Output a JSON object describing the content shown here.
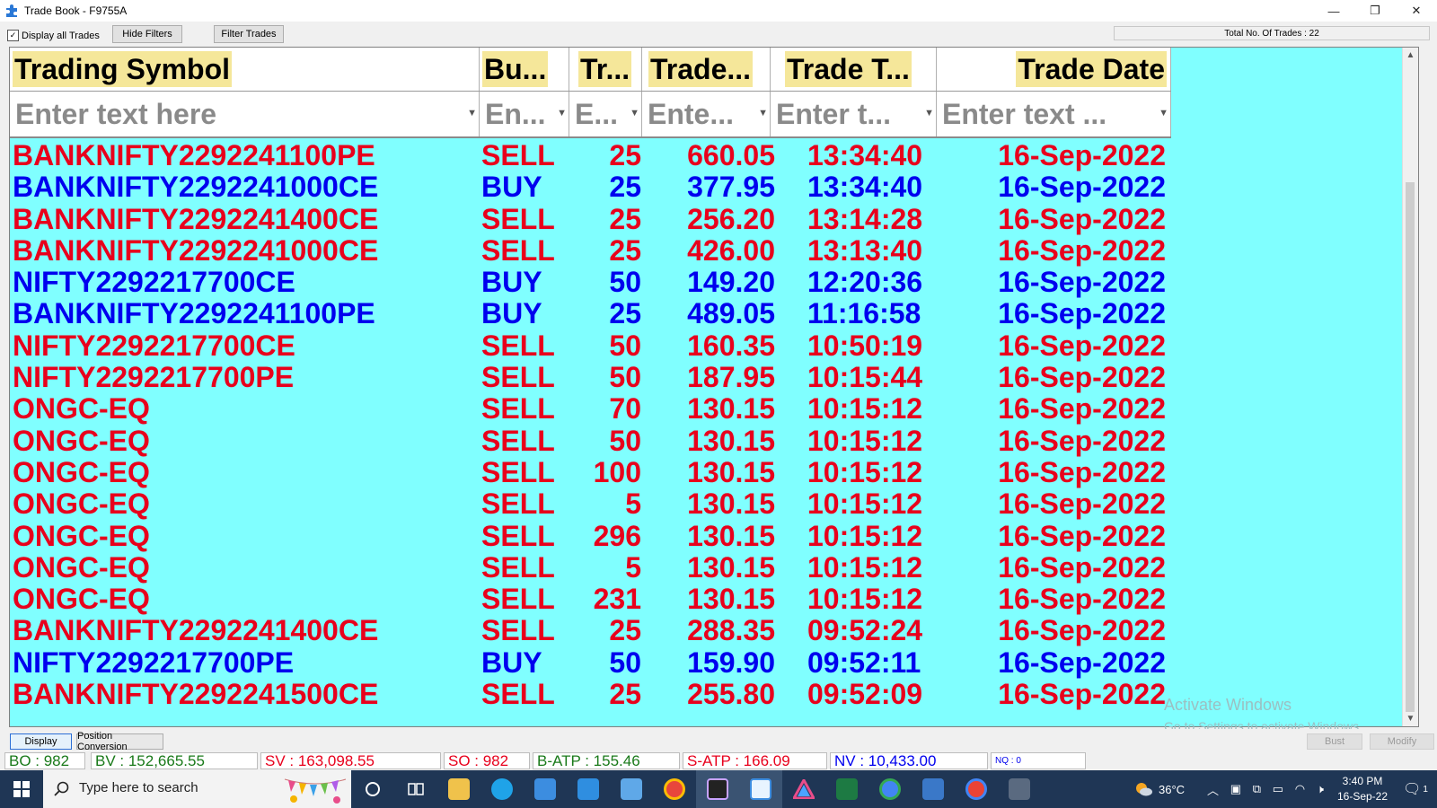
{
  "window": {
    "title": "Trade Book - F9755A",
    "controls": {
      "minimize": "—",
      "restore": "❐",
      "close": "✕"
    }
  },
  "toolbar": {
    "display_all_label": "Display all Trades",
    "display_all_checked": "✓",
    "hide_filters_label": "Hide Filters",
    "filter_trades_label": "Filter Trades",
    "total_trades": "Total No. Of Trades : 22"
  },
  "columns": [
    {
      "header": "Trading Symbol",
      "filter": "Enter text here"
    },
    {
      "header": "Bu...",
      "filter": "En..."
    },
    {
      "header": "Tr...",
      "filter": "E..."
    },
    {
      "header": "Trade...",
      "filter": "Ente..."
    },
    {
      "header": "Trade T...",
      "filter": "Enter t..."
    },
    {
      "header": "Trade Date",
      "filter": "Enter text ..."
    }
  ],
  "filter_icon": "▼",
  "trades": [
    {
      "symbol": "BANKNIFTY2292241100PE",
      "side": "SELL",
      "qty": "25",
      "price": "660.05",
      "time": "13:34:40",
      "date": "16-Sep-2022"
    },
    {
      "symbol": "BANKNIFTY2292241000CE",
      "side": "BUY",
      "qty": "25",
      "price": "377.95",
      "time": "13:34:40",
      "date": "16-Sep-2022"
    },
    {
      "symbol": "BANKNIFTY2292241400CE",
      "side": "SELL",
      "qty": "25",
      "price": "256.20",
      "time": "13:14:28",
      "date": "16-Sep-2022"
    },
    {
      "symbol": "BANKNIFTY2292241000CE",
      "side": "SELL",
      "qty": "25",
      "price": "426.00",
      "time": "13:13:40",
      "date": "16-Sep-2022"
    },
    {
      "symbol": "NIFTY2292217700CE",
      "side": "BUY",
      "qty": "50",
      "price": "149.20",
      "time": "12:20:36",
      "date": "16-Sep-2022"
    },
    {
      "symbol": "BANKNIFTY2292241100PE",
      "side": "BUY",
      "qty": "25",
      "price": "489.05",
      "time": "11:16:58",
      "date": "16-Sep-2022"
    },
    {
      "symbol": "NIFTY2292217700CE",
      "side": "SELL",
      "qty": "50",
      "price": "160.35",
      "time": "10:50:19",
      "date": "16-Sep-2022"
    },
    {
      "symbol": "NIFTY2292217700PE",
      "side": "SELL",
      "qty": "50",
      "price": "187.95",
      "time": "10:15:44",
      "date": "16-Sep-2022"
    },
    {
      "symbol": "ONGC-EQ",
      "side": "SELL",
      "qty": "70",
      "price": "130.15",
      "time": "10:15:12",
      "date": "16-Sep-2022"
    },
    {
      "symbol": "ONGC-EQ",
      "side": "SELL",
      "qty": "50",
      "price": "130.15",
      "time": "10:15:12",
      "date": "16-Sep-2022"
    },
    {
      "symbol": "ONGC-EQ",
      "side": "SELL",
      "qty": "100",
      "price": "130.15",
      "time": "10:15:12",
      "date": "16-Sep-2022"
    },
    {
      "symbol": "ONGC-EQ",
      "side": "SELL",
      "qty": "5",
      "price": "130.15",
      "time": "10:15:12",
      "date": "16-Sep-2022"
    },
    {
      "symbol": "ONGC-EQ",
      "side": "SELL",
      "qty": "296",
      "price": "130.15",
      "time": "10:15:12",
      "date": "16-Sep-2022"
    },
    {
      "symbol": "ONGC-EQ",
      "side": "SELL",
      "qty": "5",
      "price": "130.15",
      "time": "10:15:12",
      "date": "16-Sep-2022"
    },
    {
      "symbol": "ONGC-EQ",
      "side": "SELL",
      "qty": "231",
      "price": "130.15",
      "time": "10:15:12",
      "date": "16-Sep-2022"
    },
    {
      "symbol": "BANKNIFTY2292241400CE",
      "side": "SELL",
      "qty": "25",
      "price": "288.35",
      "time": "09:52:24",
      "date": "16-Sep-2022"
    },
    {
      "symbol": "NIFTY2292217700PE",
      "side": "BUY",
      "qty": "50",
      "price": "159.90",
      "time": "09:52:11",
      "date": "16-Sep-2022"
    },
    {
      "symbol": "BANKNIFTY2292241500CE",
      "side": "SELL",
      "qty": "25",
      "price": "255.80",
      "time": "09:52:09",
      "date": "16-Sep-2022"
    }
  ],
  "colors": {
    "sell": "#e8001c",
    "buy": "#0000ee",
    "grid_bg": "#80ffff",
    "header_highlight": "#f5e79a"
  },
  "watermark": {
    "line1": "Activate Windows",
    "line2": "Go to Settings to activate Windows."
  },
  "bottom_buttons": {
    "display": "Display",
    "position_conversion": "Position Conversion",
    "bust": "Bust",
    "modify": "Modify"
  },
  "status": {
    "bo": "BO : 982",
    "bv": "BV : 152,665.55",
    "sv": "SV : 163,098.55",
    "so": "SO : 982",
    "batp": "B-ATP : 155.46",
    "satp": "S-ATP : 166.09",
    "nv": "NV : 10,433.00",
    "nq": "NQ : 0"
  },
  "taskbar": {
    "search_placeholder": "Type here to search",
    "weather": "36°C",
    "time": "3:40 PM",
    "date": "16-Sep-22",
    "notification_count": "1"
  }
}
